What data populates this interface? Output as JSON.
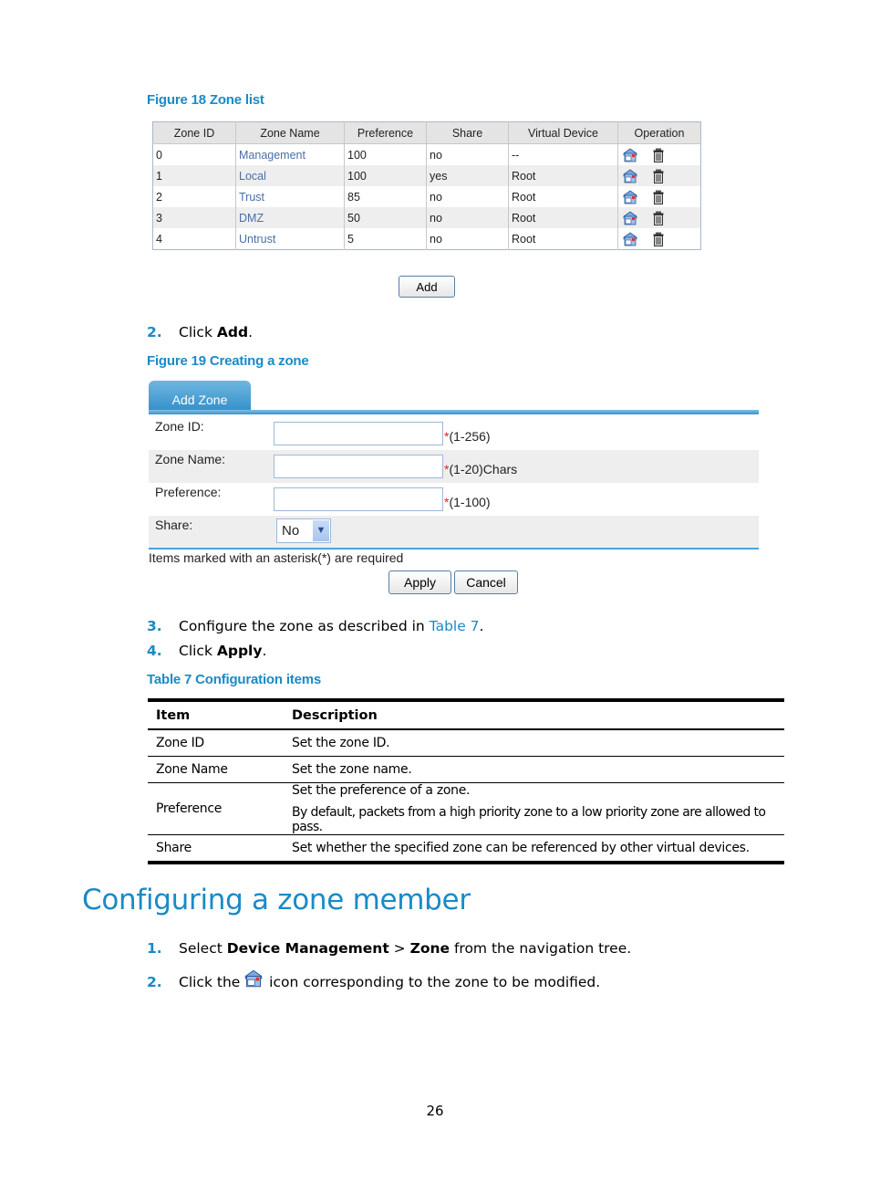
{
  "figure18": {
    "caption": "Figure 18 Zone list",
    "columns": [
      "Zone ID",
      "Zone Name",
      "Preference",
      "Share",
      "Virtual Device",
      "Operation"
    ],
    "rows": [
      {
        "id": "0",
        "name": "Management",
        "preference": "100",
        "share": "no",
        "virtual_device": "--"
      },
      {
        "id": "1",
        "name": "Local",
        "preference": "100",
        "share": "yes",
        "virtual_device": "Root"
      },
      {
        "id": "2",
        "name": "Trust",
        "preference": "85",
        "share": "no",
        "virtual_device": "Root"
      },
      {
        "id": "3",
        "name": "DMZ",
        "preference": "50",
        "share": "no",
        "virtual_device": "Root"
      },
      {
        "id": "4",
        "name": "Untrust",
        "preference": "5",
        "share": "no",
        "virtual_device": "Root"
      }
    ],
    "operation_icons": [
      "edit-icon",
      "delete-icon"
    ],
    "add_button": "Add"
  },
  "step2": {
    "num": "2.",
    "prefix": "Click ",
    "bold": "Add",
    "suffix": "."
  },
  "figure19": {
    "caption": "Figure 19 Creating a zone",
    "tab": "Add Zone",
    "fields": [
      {
        "label": "Zone ID:",
        "value": "",
        "hint": "(1-256)",
        "required": "*"
      },
      {
        "label": "Zone Name:",
        "value": "",
        "hint": "(1-20)Chars",
        "required": "*"
      },
      {
        "label": "Preference:",
        "value": "",
        "hint": "(1-100)",
        "required": "*"
      }
    ],
    "share": {
      "label": "Share:",
      "selected": "No"
    },
    "note": "Items marked with an asterisk(*) are required",
    "apply_button": "Apply",
    "cancel_button": "Cancel"
  },
  "step3": {
    "num": "3.",
    "prefix": "Configure the zone as described in ",
    "link": "Table 7",
    "suffix": "."
  },
  "step4": {
    "num": "4.",
    "prefix": "Click ",
    "bold": "Apply",
    "suffix": "."
  },
  "table7": {
    "caption": "Table 7 Configuration items",
    "headers": [
      "Item",
      "Description"
    ],
    "rows": [
      {
        "item": "Zone ID",
        "desc": [
          "Set the zone ID."
        ]
      },
      {
        "item": "Zone Name",
        "desc": [
          "Set the zone name."
        ]
      },
      {
        "item": "Preference",
        "desc": [
          "Set the preference of a zone.",
          "By default, packets from a high priority zone to a low priority zone are allowed to pass."
        ]
      },
      {
        "item": "Share",
        "desc": [
          "Set whether the specified zone can be referenced by other virtual devices."
        ]
      }
    ]
  },
  "section": {
    "title": "Configuring a zone member",
    "step1": {
      "num": "1.",
      "prefix": "Select ",
      "bold1": "Device Management",
      "mid": " > ",
      "bold2": "Zone",
      "suffix": " from the navigation tree."
    },
    "step2": {
      "num": "2.",
      "prefix": "Click the ",
      "icon": "edit-icon",
      "suffix": " icon corresponding to the zone to be modified."
    }
  },
  "page_number": "26",
  "colors": {
    "accent": "#1a8ac6",
    "link": "#4a6fa5",
    "required": "#e02020"
  }
}
